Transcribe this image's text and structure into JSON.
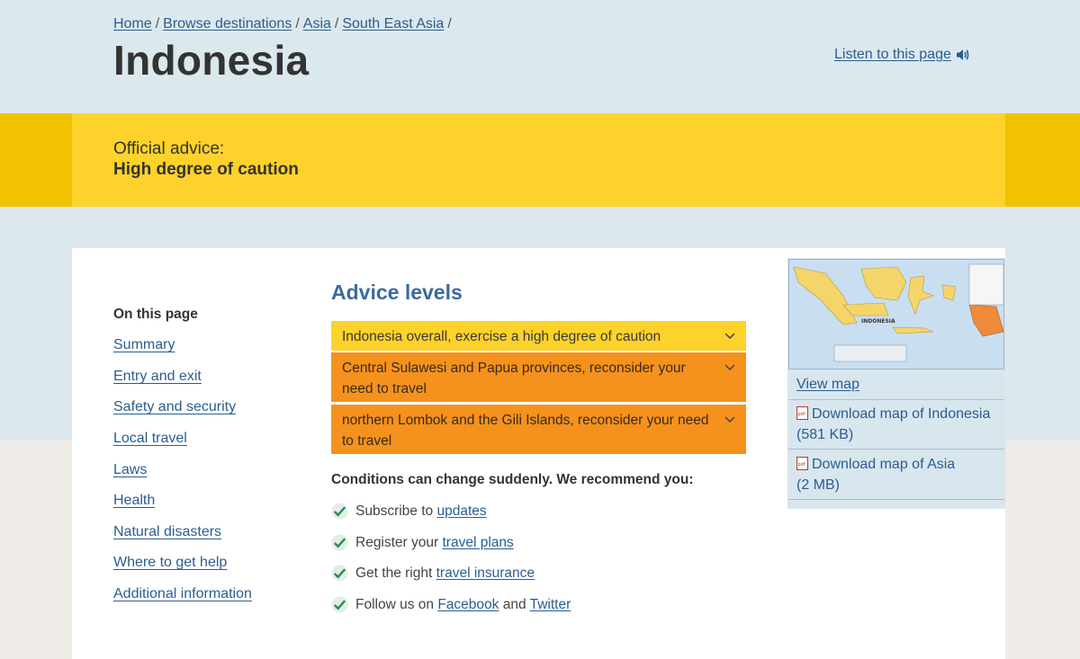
{
  "breadcrumb": {
    "items": [
      "Home",
      "Browse destinations",
      "Asia",
      "South East Asia"
    ],
    "separator": "/"
  },
  "page": {
    "title": "Indonesia",
    "listen_label": "Listen to this page"
  },
  "advice": {
    "label": "Official advice:",
    "level": "High degree of caution"
  },
  "toc": {
    "title": "On this page",
    "items": [
      "Summary",
      "Entry and exit",
      "Safety and security",
      "Local travel",
      "Laws",
      "Health",
      "Natural disasters",
      "Where to get help",
      "Additional information"
    ]
  },
  "advice_levels": {
    "title": "Advice levels",
    "items": [
      {
        "text": "Indonesia overall, exercise a high degree of caution",
        "color": "#fdd22a"
      },
      {
        "text": "Central Sulawesi and Papua provinces, reconsider your need to travel",
        "color": "#f5921e"
      },
      {
        "text": "northern Lombok and the Gili Islands, reconsider your need to travel",
        "color": "#f5921e"
      }
    ]
  },
  "recommendations": {
    "heading": "Conditions can change suddenly. We recommend you:",
    "items": [
      {
        "prefix": "Subscribe to ",
        "link1": "updates"
      },
      {
        "prefix": "Register your ",
        "link1": "travel plans"
      },
      {
        "prefix": "Get the right ",
        "link1": "travel insurance"
      },
      {
        "prefix": "Follow us on ",
        "link1": "Facebook",
        "middle": " and ",
        "link2": "Twitter"
      }
    ]
  },
  "map": {
    "image_label": "INDONESIA",
    "view_label": "View map",
    "downloads": [
      {
        "line1": "Download map of Indonesia",
        "line2": "(581 KB)"
      },
      {
        "line1": "Download map of Asia",
        "line2": "(2 MB)"
      }
    ]
  },
  "colors": {
    "accent_link": "#2a5d8f",
    "band_yellow": "#fdd22a",
    "warning_orange": "#f5921e",
    "check_green": "#2e8b57"
  }
}
